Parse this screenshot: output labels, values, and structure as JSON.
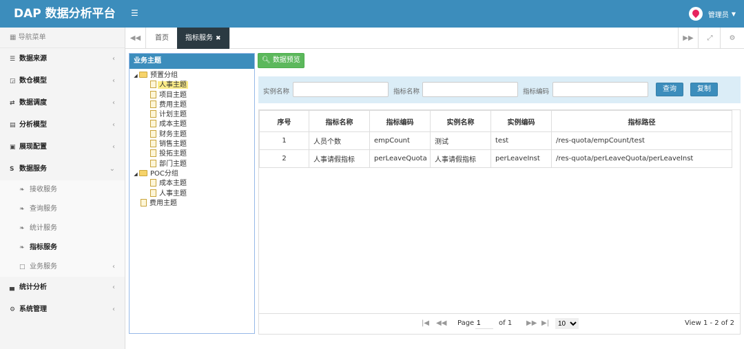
{
  "app": {
    "title": "DAP 数据分析平台",
    "user": "管理员"
  },
  "sidebar": {
    "header": "导航菜单",
    "items": [
      {
        "label": "数据来源"
      },
      {
        "label": "数仓模型"
      },
      {
        "label": "数据调度"
      },
      {
        "label": "分析模型"
      },
      {
        "label": "展现配置"
      },
      {
        "label": "数据服务"
      },
      {
        "label": "统计分析"
      },
      {
        "label": "系统管理"
      }
    ],
    "sub_items": [
      {
        "label": "接收服务"
      },
      {
        "label": "查询服务"
      },
      {
        "label": "统计服务"
      },
      {
        "label": "指标服务"
      },
      {
        "label": "业务服务"
      }
    ]
  },
  "tabs": {
    "home": "首页",
    "active": "指标服务"
  },
  "tree": {
    "title": "业务主题",
    "group1": "预置分组",
    "group1_items": [
      "人事主题",
      "项目主题",
      "费用主题",
      "计划主题",
      "成本主题",
      "财务主题",
      "销售主题",
      "投拓主题",
      "部门主题"
    ],
    "group2": "POC分组",
    "group2_items": [
      "成本主题",
      "人事主题"
    ],
    "root_item": "费用主题"
  },
  "toolbar": {
    "preview_label": "数据预览"
  },
  "search": {
    "instance_name_label": "实例名称",
    "indicator_name_label": "指标名称",
    "indicator_code_label": "指标编码",
    "query_label": "查询",
    "copy_label": "复制"
  },
  "table": {
    "headers": [
      "序号",
      "指标名称",
      "指标编码",
      "实例名称",
      "实例编码",
      "指标路径"
    ],
    "rows": [
      [
        "1",
        "人员个数",
        "empCount",
        "测试",
        "test",
        "/res-quota/empCount/test"
      ],
      [
        "2",
        "人事请假指标",
        "perLeaveQuota",
        "人事请假指标",
        "perLeaveInst",
        "/res-quota/perLeaveQuota/perLeaveInst"
      ]
    ]
  },
  "pager": {
    "page_label": "Page",
    "page_value": "1",
    "of_label": "of 1",
    "page_size": "10",
    "summary": "View 1 - 2 of 2"
  }
}
